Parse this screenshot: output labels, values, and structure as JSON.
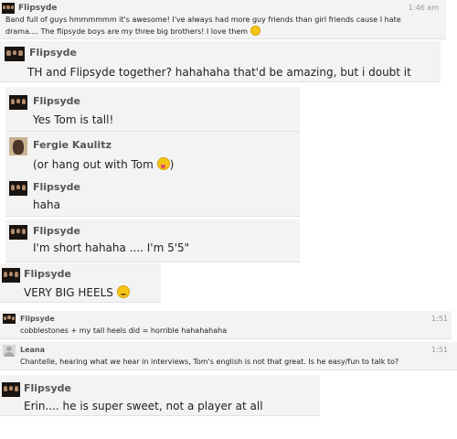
{
  "posts": [
    {
      "name": "Flipsyde",
      "time": "1:46 am",
      "line1": "Band full of guys hmmmmmm it's awesome! I've always had more guy friends than girl friends cause I hate",
      "line2": "drama.... The flipsyde boys are my three big brothers! I love them",
      "emoji": "smile-emoji"
    },
    {
      "name": "Flipsyde",
      "text": "TH and Flipsyde together? hahahaha that'd be amazing, but i doubt it"
    },
    {
      "name": "Flipsyde",
      "text": "Yes Tom is tall!"
    },
    {
      "name": "Fergie Kaulitz",
      "text": "(or hang out with Tom",
      "text_end": ")",
      "emoji": "tongue-emoji"
    },
    {
      "name": "Flipsyde",
      "text": "haha"
    },
    {
      "name": "Flipsyde",
      "text": "I'm short hahaha .... I'm 5'5\""
    },
    {
      "name": "Flipsyde",
      "text": "VERY BIG HEELS",
      "emoji": "wink-emoji"
    },
    {
      "name": "Flipsyde",
      "time": "1:51",
      "text": "cobblestones + my tall heels did = horrible hahahahaha"
    },
    {
      "name": "Leana",
      "time": "1:51",
      "text": "Chantelle, hearing what we hear in interviews, Tom's english is not that great. Is he easy/fun to talk to?"
    },
    {
      "name": "Flipsyde",
      "text": "Erin.... he is super sweet, not a player at all"
    }
  ]
}
